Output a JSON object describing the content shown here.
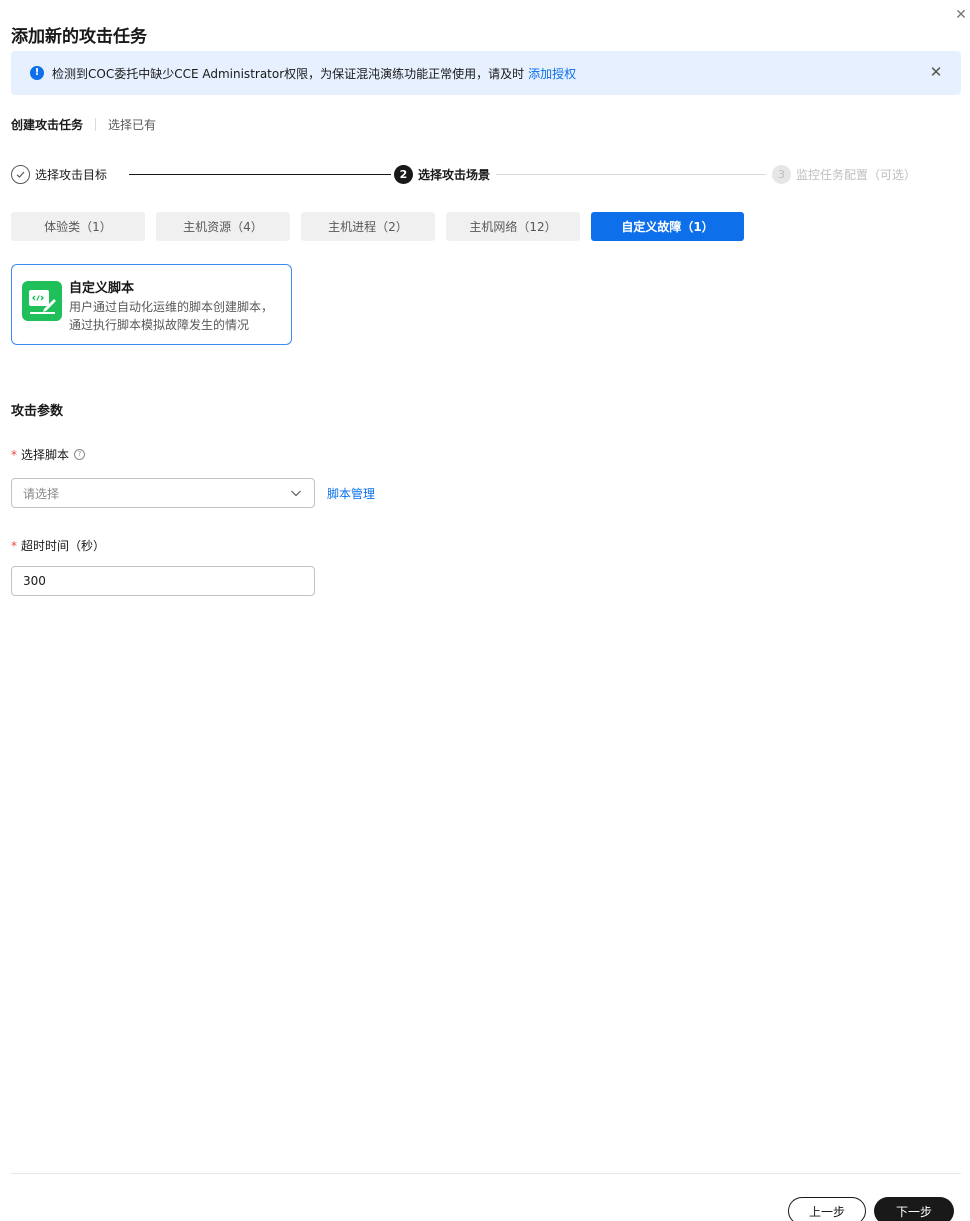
{
  "dialog": {
    "title": "添加新的攻击任务",
    "close_icon": "close-icon"
  },
  "alert": {
    "message": "检测到COC委托中缺少CCE Administrator权限，为保证混沌演练功能正常使用，请及时",
    "link": "添加授权",
    "icon": "info-icon",
    "accent": "#0d6fea",
    "background": "#e6f0fe"
  },
  "mode_tabs": {
    "create": "创建攻击任务",
    "existing": "选择已有"
  },
  "steps": [
    {
      "number": "✓",
      "label": "选择攻击目标",
      "status": "done"
    },
    {
      "number": "2",
      "label": "选择攻击场景",
      "status": "active"
    },
    {
      "number": "3",
      "label": "监控任务配置（可选）",
      "status": "pending"
    }
  ],
  "category_tabs": [
    {
      "label": "体验类（1）",
      "active": false
    },
    {
      "label": "主机资源（4）",
      "active": false
    },
    {
      "label": "主机进程（2）",
      "active": false
    },
    {
      "label": "主机网络（12）",
      "active": false
    },
    {
      "label": "自定义故障（1）",
      "active": true
    }
  ],
  "scenario": {
    "title": "自定义脚本",
    "description_line1": "用户通过自动化运维的脚本创建脚本，",
    "description_line2": "通过执行脚本模拟故障发生的情况",
    "icon": "script-edit-icon",
    "icon_color": "#1fbf5a"
  },
  "attack_params": {
    "section_title": "攻击参数",
    "script_label": "选择脚本",
    "script_placeholder": "请选择",
    "script_manage_link": "脚本管理",
    "timeout_label": "超时时间（秒）",
    "timeout_value": "300",
    "required_mark": "*"
  },
  "footer": {
    "prev_label": "上一步",
    "next_label": "下一步"
  }
}
